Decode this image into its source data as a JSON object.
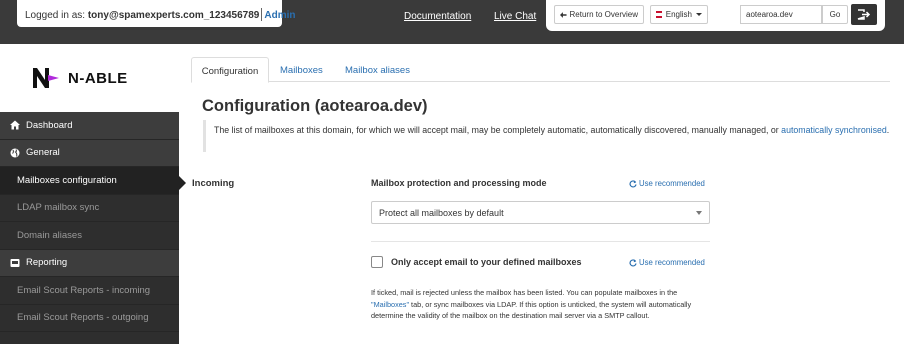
{
  "topbar": {
    "login_prefix": "Logged in as:",
    "user": "tony@spamexperts.com_123456789",
    "admin_link": "Admin",
    "documentation": "Documentation",
    "live_chat": "Live Chat",
    "return_button": "Return to Overview",
    "language": "English",
    "domain_value": "aotearoa.dev",
    "go_button": "Go"
  },
  "logo": {
    "text": "N-ABLE"
  },
  "sidebar": {
    "items": [
      {
        "label": "Dashboard",
        "type": "header",
        "icon": "home-icon"
      },
      {
        "label": "General",
        "type": "header",
        "icon": "globe-icon"
      },
      {
        "label": "Mailboxes configuration",
        "type": "sub",
        "active": true
      },
      {
        "label": "LDAP mailbox sync",
        "type": "sub"
      },
      {
        "label": "Domain aliases",
        "type": "sub"
      },
      {
        "label": "Reporting",
        "type": "header",
        "icon": "report-icon"
      },
      {
        "label": "Email Scout Reports - incoming",
        "type": "sub"
      },
      {
        "label": "Email Scout Reports - outgoing",
        "type": "sub"
      }
    ]
  },
  "tabs": [
    "Configuration",
    "Mailboxes",
    "Mailbox aliases"
  ],
  "page_title": "Configuration (aotearoa.dev)",
  "info": {
    "text": "The list of mailboxes at this domain, for which we will accept mail, may be completely automatic, automatically discovered, manually managed, or ",
    "link": "automatically synchronised",
    "suffix": "."
  },
  "incoming": {
    "section_label": "Incoming",
    "mode_label": "Mailbox protection and processing mode",
    "use_recommended": "Use recommended",
    "mode_value": "Protect all mailboxes by default",
    "checkbox_label": "Only accept email to your defined mailboxes",
    "help_prefix": "If ticked, mail is rejected unless the mailbox has been listed. You can populate mailboxes in the ",
    "help_link": "\"Mailboxes\"",
    "help_suffix": " tab, or sync mailboxes via LDAP. If this option is unticked, the system will automatically determine the validity of the mailbox on the destination mail server via a SMTP callout."
  },
  "colors": {
    "accent": "#2a6fb0",
    "topbar": "#3a3a3a",
    "sidebar": "#2e2e2e"
  }
}
